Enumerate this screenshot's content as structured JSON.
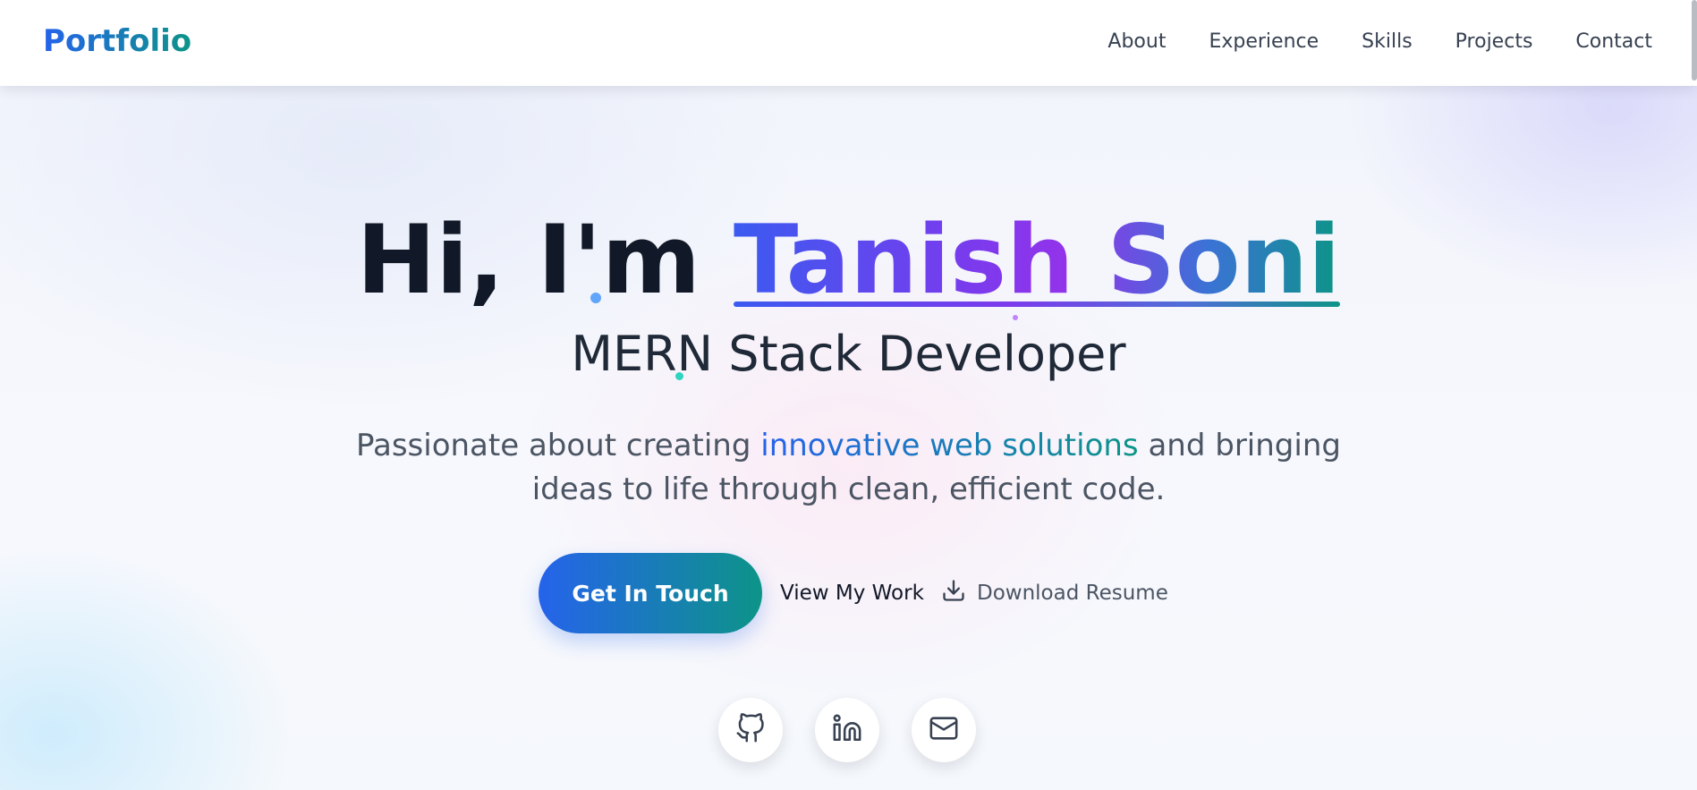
{
  "header": {
    "logo": "Portfolio",
    "nav": [
      "About",
      "Experience",
      "Skills",
      "Projects",
      "Contact"
    ]
  },
  "hero": {
    "greeting": "Hi, I'm",
    "name": "Tanish Soni",
    "role": "MERN Stack Developer",
    "tagline_before": "Passionate about creating",
    "tagline_highlight": "innovative web solutions",
    "tagline_after": "and bringing ideas to life through clean, efficient code."
  },
  "actions": {
    "primary": "Get In Touch",
    "secondary": "View My Work",
    "resume": "Download Resume"
  },
  "social": [
    "github-icon",
    "linkedin-icon",
    "mail-icon"
  ],
  "colors": {
    "accent_blue": "#2563eb",
    "accent_teal": "#0d9488",
    "accent_purple": "#9333ea",
    "text_dark": "#111827"
  }
}
